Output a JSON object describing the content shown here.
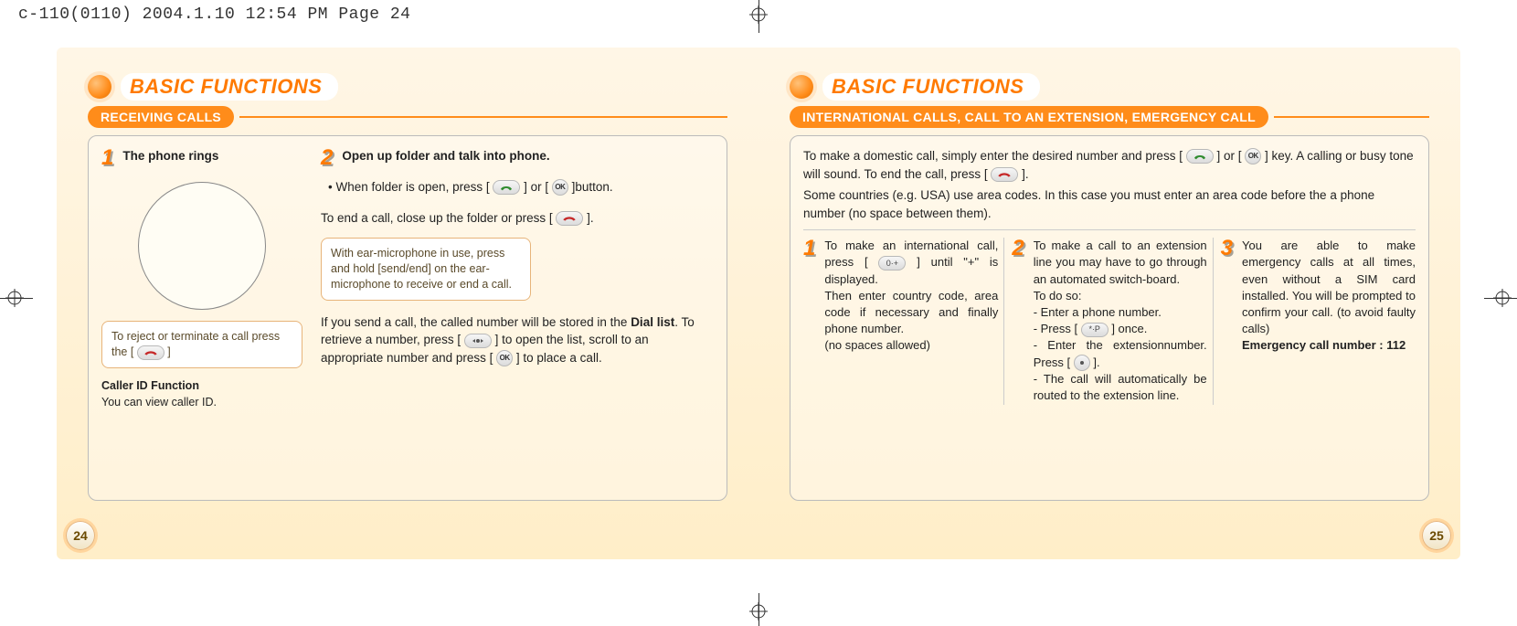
{
  "print_header": "c-110(0110)  2004.1.10  12:54 PM  Page 24",
  "basic_functions_label": "BASIC FUNCTIONS",
  "left": {
    "section": "RECEIVING CALLS",
    "step1_num": "1",
    "step1_title": "The phone rings",
    "reject_note_a": "To reject or terminate a call press the [",
    "reject_note_b": " ]",
    "caller_id_title": "Caller ID Function",
    "caller_id_text": "You can view caller ID.",
    "step2_num": "2",
    "step2_title": "Open up folder and talk into phone.",
    "open_a": "When folder is open, press [ ",
    "open_b": " ] or [   ",
    "open_c": "  ]button.",
    "end_a": "To end a call, close up the folder or press [ ",
    "end_b": "  ].",
    "ear_note": "With ear-microphone in use, press and hold [send/end] on the ear-microphone to receive or end a call.",
    "dial_a": "If you send a call, the called number will be stored in the ",
    "dial_bold": "Dial list",
    "dial_b": ". To retrieve a number, press  [ ",
    "dial_c": " ] to open the list, scroll to an appropriate number and press [   ",
    "dial_d": "  ] to place a call.",
    "pagenum": "24"
  },
  "right": {
    "section": "INTERNATIONAL CALLS, CALL TO AN EXTENSION, EMERGENCY CALL",
    "intro_a": "To make a domestic call, simply enter the desired number and press [ ",
    "intro_b": " ] or [ ",
    "intro_c": " ] key. A calling or busy tone will sound. To end the call, press [ ",
    "intro_d": " ].",
    "intro2": "Some countries (e.g. USA) use area codes. In this case you must enter an area code before the a phone number (no space between them).",
    "step1_num": "1",
    "step1_a": "To make an international call, press [ ",
    "step1_b": " ] until \"+\" is displayed.",
    "step1_c": "Then enter country code, area code if necessary and finally phone number.",
    "step1_d": "(no spaces allowed)",
    "step2_num": "2",
    "step2_a": "To make a call to an extension line you may have to go through an automated switch-board.",
    "step2_b": "To do so:",
    "step2_c": "- Enter a phone number.",
    "step2_d_a": "- Press [ ",
    "step2_d_b": " ] once.",
    "step2_e": "- Enter the extensionnumber. Press [   ",
    "step2_e2": "  ].",
    "step2_f": "- The call will automatically be routed to the extension line.",
    "step3_num": "3",
    "step3_a": "You are able to make emergency calls at all times, even without a SIM card installed. You will be prompted to confirm your call. (to avoid faulty calls)",
    "step3_b": "Emergency call number : 112",
    "pagenum": "25"
  },
  "icons": {
    "send_key": "send",
    "end_key": "end",
    "ok_key": "OK",
    "nav_key": "nav",
    "star_key": "*·P",
    "zero_key": "0·+"
  }
}
